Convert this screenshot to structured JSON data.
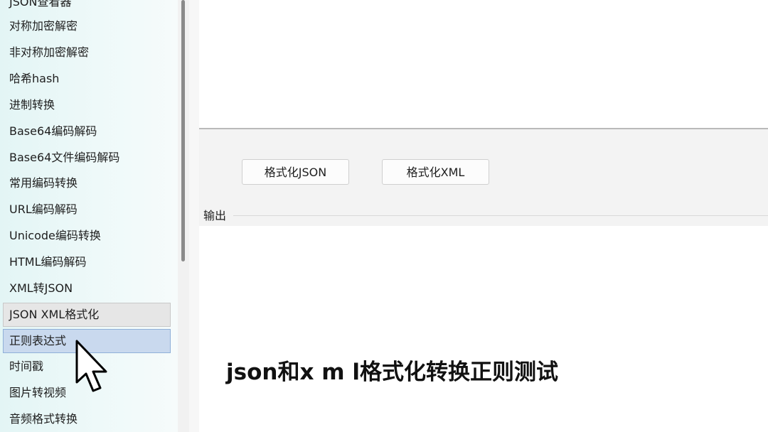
{
  "sidebar": {
    "items": [
      {
        "label": "JSON查看器"
      },
      {
        "label": "对称加密解密"
      },
      {
        "label": "非对称加密解密"
      },
      {
        "label": "哈希hash"
      },
      {
        "label": "进制转换"
      },
      {
        "label": "Base64编码解码"
      },
      {
        "label": "Base64文件编码解码"
      },
      {
        "label": "常用编码转换"
      },
      {
        "label": "URL编码解码"
      },
      {
        "label": "Unicode编码转换"
      },
      {
        "label": "HTML编码解码"
      },
      {
        "label": "XML转JSON"
      },
      {
        "label": "JSON XML格式化"
      },
      {
        "label": "正则表达式"
      },
      {
        "label": "时间戳"
      },
      {
        "label": "图片转视频"
      },
      {
        "label": "音频格式转换"
      }
    ]
  },
  "toolbar": {
    "format_json_label": "格式化JSON",
    "format_xml_label": "格式化XML"
  },
  "output": {
    "group_label": "输出"
  },
  "overlay": {
    "caption": "json和x m l格式化转换正则测试"
  },
  "colors": {
    "sidebar_bg": "#e3f5f5",
    "selected_bg": "#e6e6e6",
    "hover_bg": "#c9d9ee",
    "hover_border": "#8fb0d8"
  }
}
